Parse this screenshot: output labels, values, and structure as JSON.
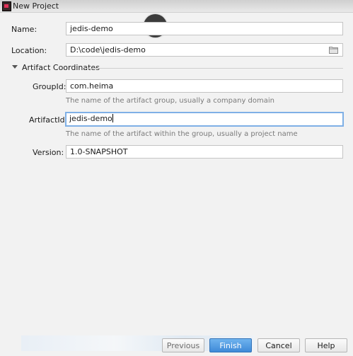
{
  "window": {
    "title": "New Project"
  },
  "form": {
    "name_label": "Name:",
    "name_value": "jedis-demo",
    "location_label": "Location:",
    "location_value": "D:\\code\\jedis-demo"
  },
  "artifact": {
    "section_title": "Artifact Coordinates",
    "groupid_label": "GroupId:",
    "groupid_value": "com.heima",
    "groupid_hint": "The name of the artifact group, usually a company domain",
    "artifactid_label": "ArtifactId:",
    "artifactid_value": "jedis-demo",
    "artifactid_hint": "The name of the artifact within the group, usually a project name",
    "version_label": "Version:",
    "version_value": "1.0-SNAPSHOT"
  },
  "footer": {
    "previous_label": "Previous",
    "finish_label": "Finish",
    "cancel_label": "Cancel",
    "help_label": "Help"
  },
  "colors": {
    "accent": "#4a90dd",
    "focus_border": "#7fb0e6"
  },
  "icons": {
    "app": "intellij-app-icon",
    "overlay_close": "close-icon",
    "location_browse": "folder-icon",
    "section_toggle": "triangle-down-icon"
  }
}
